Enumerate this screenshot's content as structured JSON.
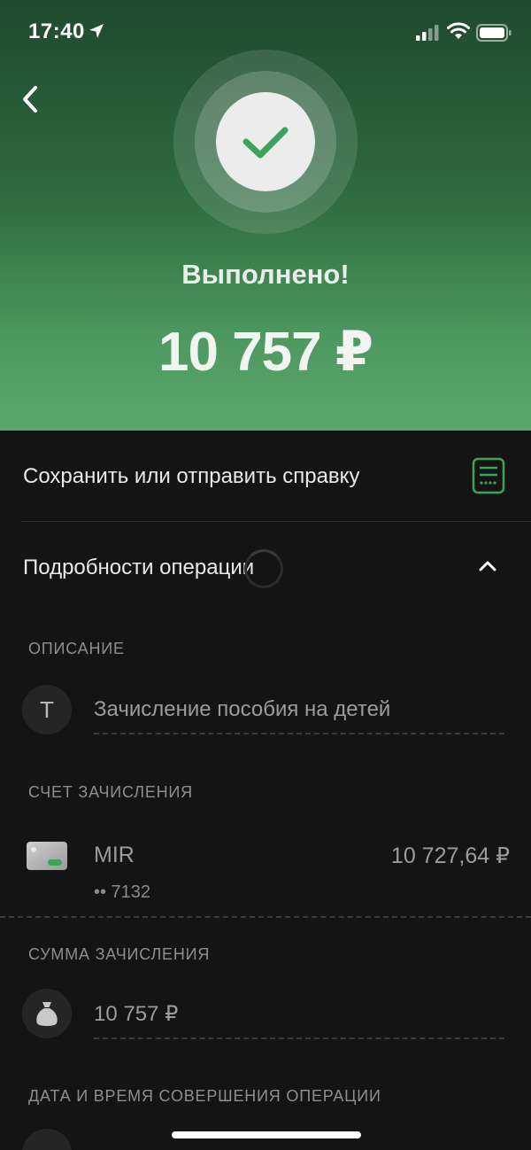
{
  "status_bar": {
    "time": "17:40"
  },
  "header": {
    "status_title": "Выполнено!",
    "amount": "10 757 ₽"
  },
  "actions": {
    "save_label": "Сохранить или отправить справку",
    "details_label": "Подробности операции"
  },
  "description": {
    "section_label": "ОПИСАНИЕ",
    "icon_letter": "Т",
    "value": "Зачисление пособия на детей"
  },
  "account": {
    "section_label": "СЧЕТ ЗАЧИСЛЕНИЯ",
    "card_name": "MIR",
    "balance": "10 727,64 ₽",
    "card_mask": "•• 7132"
  },
  "sum": {
    "section_label": "СУММА ЗАЧИСЛЕНИЯ",
    "value": "10 757 ₽"
  },
  "datetime": {
    "section_label": "ДАТА И ВРЕМЯ СОВЕРШЕНИЯ ОПЕРАЦИИ"
  },
  "colors": {
    "accent_green": "#3da35a",
    "header_top": "#1f4a2d",
    "header_bottom": "#5aa66b",
    "background": "#141414"
  }
}
